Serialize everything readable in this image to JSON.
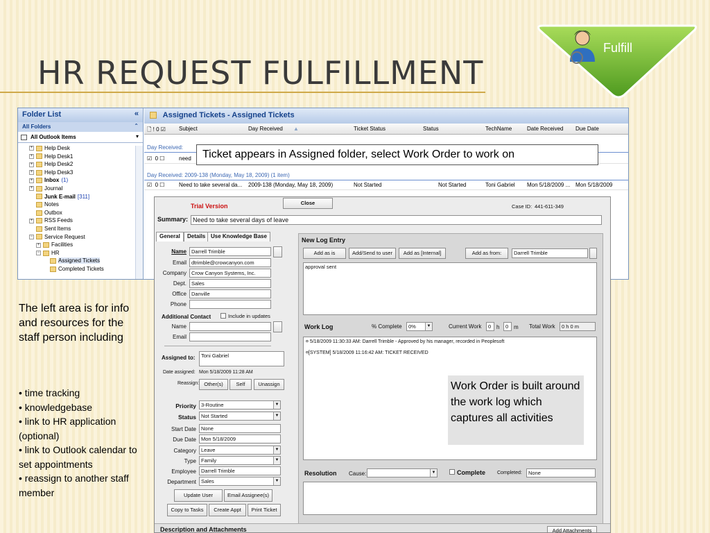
{
  "slide": {
    "title": "HR REQUEST FULFILLMENT",
    "badge_label": "Fulfill"
  },
  "folder_pane": {
    "header": "Folder List",
    "collapse_glyph": "«",
    "all_folders": "All Folders",
    "selector": "All Outlook Items",
    "items": [
      {
        "label": "Help Desk",
        "indent": 1,
        "expand": "+"
      },
      {
        "label": "Help Desk1",
        "indent": 1,
        "expand": "+"
      },
      {
        "label": "Help Desk2",
        "indent": 1,
        "expand": "+"
      },
      {
        "label": "Help Desk3",
        "indent": 1,
        "expand": "+"
      },
      {
        "label": "Inbox",
        "count": "(1)",
        "indent": 1,
        "expand": "+",
        "bold": true
      },
      {
        "label": "Journal",
        "indent": 1,
        "expand": "+"
      },
      {
        "label": "Junk E-mail",
        "count": "[311]",
        "indent": 1,
        "bold": true
      },
      {
        "label": "Notes",
        "indent": 1
      },
      {
        "label": "Outbox",
        "indent": 1
      },
      {
        "label": "RSS Feeds",
        "indent": 1,
        "expand": "+"
      },
      {
        "label": "Sent Items",
        "indent": 1
      },
      {
        "label": "Service Request",
        "indent": 1,
        "expand": "−"
      },
      {
        "label": "Facilities",
        "indent": 2,
        "expand": "+"
      },
      {
        "label": "HR",
        "indent": 2,
        "expand": "−"
      },
      {
        "label": "Assigned Tickets",
        "indent": 3,
        "selected": true
      },
      {
        "label": "Completed Tickets",
        "indent": 3
      }
    ]
  },
  "tickets_pane": {
    "header": "Assigned Tickets - Assigned Tickets",
    "columns": {
      "icons": "🗋 ! 0 ☑",
      "subject": "Subject",
      "day_received": "Day Received",
      "ticket_status": "Ticket Status",
      "status": "Status",
      "tech_name": "TechName",
      "date_received": "Date Received",
      "due_date": "Due Date"
    },
    "group1": "Day Received: ",
    "row1_subject": "need",
    "group2": "Day Received: 2009-138 (Monday, May 18, 2009) (1 item)",
    "row2": {
      "subject": "Need to take several da...",
      "day_received": "2009-138 (Monday, May 18, 2009)",
      "ticket_status": "Not Started",
      "status": "Not Started",
      "tech_name": "Toni Gabriel",
      "date_received": "Mon 5/18/2009 ...",
      "due_date": "Mon 5/18/2009"
    }
  },
  "callouts": {
    "assigned": "Ticket appears in Assigned folder, select Work Order to work on",
    "work_order": "Work Order is built around the work log which captures all activities"
  },
  "work_order": {
    "trial": "Trial Version",
    "close": "Close",
    "case_id_label": "Case ID:",
    "case_id": "441-611-349",
    "summary_label": "Summary:",
    "summary": "Need to take several days of leave",
    "tabs": [
      "General",
      "Details",
      "Use Knowledge Base"
    ],
    "contact": {
      "name_label": "Name",
      "name": "Darrell Trimble",
      "email_label": "Email",
      "email": "dtrimble@crowcanyon.com",
      "company_label": "Company",
      "company": "Crow Canyon Systems, Inc.",
      "dept_label": "Dept.",
      "dept": "Sales",
      "office_label": "Office",
      "office": "Danville",
      "phone_label": "Phone",
      "phone": ""
    },
    "additional_contact": "Additional Contact",
    "include_updates": "Include in updates",
    "add_name_label": "Name",
    "add_email_label": "Email",
    "assigned_to_label": "Assigned to:",
    "assigned_to": "Toni Gabriel",
    "date_assigned_label": "Date assigned:",
    "date_assigned": "Mon 5/18/2009 11:28 AM",
    "reassign_label": "Reassign:",
    "reassign_buttons": [
      "Other(s)",
      "Self",
      "Unassign"
    ],
    "fields": {
      "priority_label": "Priority",
      "priority": "3-Routine",
      "status_label": "Status",
      "status": "Not Started",
      "start_label": "Start Date",
      "start": "None",
      "due_label": "Due Date",
      "due": "Mon 5/18/2009",
      "category_label": "Category",
      "category": "Leave",
      "type_label": "Type",
      "type": "Family",
      "employee_label": "Employee",
      "employee": "Darrell Trimble",
      "department_label": "Department",
      "department": "Sales"
    },
    "buttons": {
      "update_user": "Update User",
      "email_assignee": "Email Assignee(s)",
      "copy_tasks": "Copy to Tasks",
      "create_appt": "Create Appt",
      "print_ticket": "Print Ticket"
    },
    "new_log_entry": "New Log Entry",
    "log_buttons": [
      "Add as is",
      "Add/Send to user",
      "Add as [Internal]",
      "Add as from:"
    ],
    "add_from": "Darrell Trimble",
    "log_text": "approval sent",
    "work_log_label": "Work Log",
    "pct_complete_label": "% Complete",
    "pct_complete": "0%",
    "current_work_label": "Current Work",
    "current_work_h": "0",
    "current_work_m": "0",
    "h": "h",
    "m": "m",
    "total_work_label": "Total Work",
    "total_work": "0 h  0 m",
    "work_log_entries": [
      "¤ 5/18/2009 11:30:33 AM: Darrell Trimble - Approved by his manager, recorded in Peoplesoft",
      "¤[SYSTEM] 5/18/2009 11:16:42 AM: TICKET RECEIVED"
    ],
    "resolution_label": "Resolution",
    "cause_label": "Cause:",
    "complete_label": "Complete",
    "completed_label": "Completed:",
    "completed": "None",
    "description_label": "Description and Attachments",
    "add_attachments": "Add Attachments"
  },
  "left_text": {
    "intro": "The left area is for info and resources for the staff person including",
    "bullets": [
      "• time tracking",
      "• knowledgebase",
      "• link to HR application (optional)",
      "• link to Outlook calendar to set appointments",
      "• reassign to another staff member"
    ]
  }
}
